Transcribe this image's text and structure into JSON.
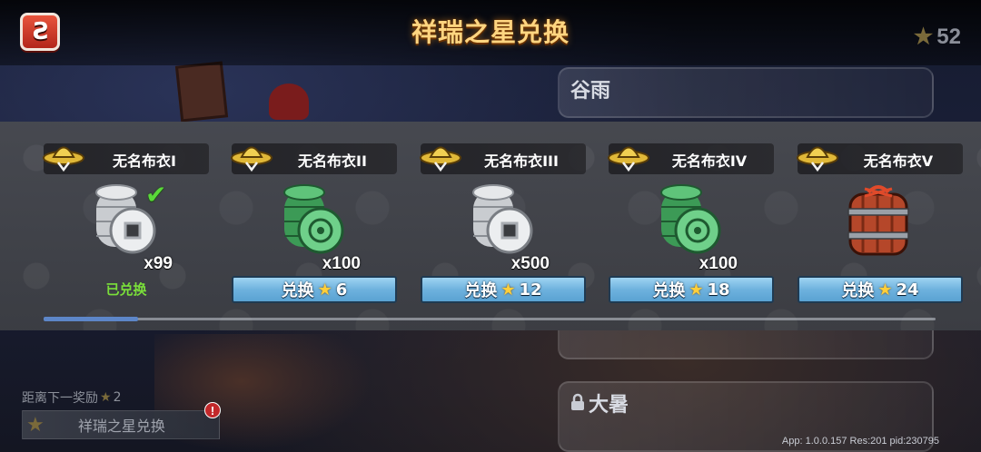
{
  "header": {
    "title": "祥瑞之星兑换",
    "star_total": "52"
  },
  "season_cards": {
    "top_name": "谷雨",
    "bottom_name": "大暑"
  },
  "rewards": [
    {
      "name": "无名布衣I",
      "quantity": "x99",
      "status": "已兑换",
      "redeemed": true,
      "icon": "silver-coin-stack-icon"
    },
    {
      "name": "无名布衣II",
      "quantity": "x100",
      "button_label": "兑换",
      "cost": "6",
      "redeemed": false,
      "icon": "jade-coin-stack-icon"
    },
    {
      "name": "无名布衣III",
      "quantity": "x500",
      "button_label": "兑换",
      "cost": "12",
      "redeemed": false,
      "icon": "silver-coin-stack-icon"
    },
    {
      "name": "无名布衣IV",
      "quantity": "x100",
      "button_label": "兑换",
      "cost": "18",
      "redeemed": false,
      "icon": "jade-coin-stack-icon"
    },
    {
      "name": "无名布衣V",
      "quantity": "",
      "button_label": "兑换",
      "cost": "24",
      "redeemed": false,
      "icon": "firecracker-bundle-icon"
    }
  ],
  "scroll": {
    "position": 0.0
  },
  "bottom": {
    "next_reward_label": "距离下一奖励",
    "next_reward_stars": "2",
    "button_label": "祥瑞之星兑换",
    "alert": "!"
  },
  "build_info": "App: 1.0.0.157 Res:201 pid:230795",
  "colors": {
    "title": "#ffd580",
    "button": "#6eb2de",
    "redeemed": "#7adf3a",
    "star": "#ffcf3a"
  }
}
